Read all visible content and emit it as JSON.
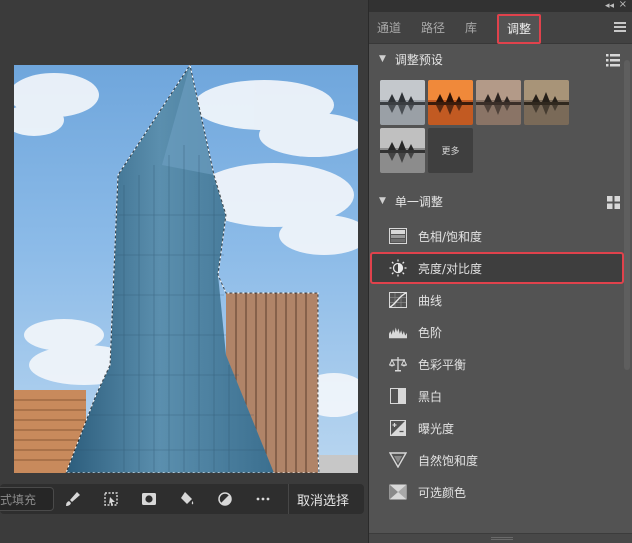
{
  "panel": {
    "tabs": [
      {
        "label": "通道"
      },
      {
        "label": "路径"
      },
      {
        "label": "库"
      },
      {
        "label": "调整"
      }
    ],
    "active_tab": "调整"
  },
  "presets": {
    "title": "调整预设",
    "more_label": "更多",
    "thumbnails": [
      {
        "icon": "landscape-gray-icon"
      },
      {
        "icon": "landscape-sunset-icon"
      },
      {
        "icon": "landscape-warm-icon"
      },
      {
        "icon": "landscape-sepia-icon"
      },
      {
        "icon": "landscape-bw-icon"
      }
    ]
  },
  "single_adjustments": {
    "title": "单一调整",
    "items": [
      {
        "label": "色相/饱和度",
        "icon": "hue-saturation-icon"
      },
      {
        "label": "亮度/对比度",
        "icon": "brightness-contrast-icon",
        "highlighted": true
      },
      {
        "label": "曲线",
        "icon": "curves-icon"
      },
      {
        "label": "色阶",
        "icon": "levels-icon"
      },
      {
        "label": "色彩平衡",
        "icon": "color-balance-icon"
      },
      {
        "label": "黑白",
        "icon": "black-white-icon"
      },
      {
        "label": "曝光度",
        "icon": "exposure-icon"
      },
      {
        "label": "自然饱和度",
        "icon": "vibrance-icon"
      },
      {
        "label": "可选颜色",
        "icon": "selective-color-icon"
      }
    ]
  },
  "taskbar": {
    "fill_text": "式填充",
    "deselect_label": "取消选择",
    "tools": [
      {
        "icon": "brush-icon"
      },
      {
        "icon": "transform-selection-icon"
      },
      {
        "icon": "mask-icon"
      },
      {
        "icon": "fill-bucket-icon"
      },
      {
        "icon": "adjustment-circle-icon"
      },
      {
        "icon": "more-icon"
      }
    ]
  },
  "colors": {
    "highlight": "#e0424c",
    "panel_bg": "#535353"
  }
}
